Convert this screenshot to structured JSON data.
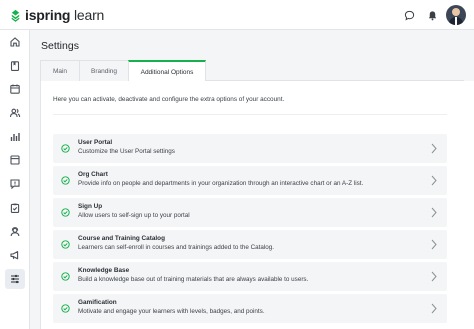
{
  "app": {
    "logo_main": "ispring",
    "logo_accent": "learn"
  },
  "header_icons": [
    "chat-icon",
    "bell-icon",
    "user-avatar"
  ],
  "sidebar": {
    "items": [
      {
        "icon": "home-icon"
      },
      {
        "icon": "courses-icon"
      },
      {
        "icon": "calendar-icon"
      },
      {
        "icon": "users-icon"
      },
      {
        "icon": "reports-icon"
      },
      {
        "icon": "content-icon"
      },
      {
        "icon": "feedback-icon"
      },
      {
        "icon": "assignments-icon"
      },
      {
        "icon": "support-icon"
      },
      {
        "icon": "announcements-icon"
      },
      {
        "icon": "settings-sliders-icon",
        "active": true
      }
    ]
  },
  "page": {
    "title": "Settings",
    "tabs": [
      {
        "label": "Main"
      },
      {
        "label": "Branding"
      },
      {
        "label": "Additional Options",
        "active": true
      }
    ],
    "intro": "Here you can activate, deactivate and configure the extra options of your account."
  },
  "options": [
    {
      "name": "User Portal",
      "description": "Customize the User Portal settings",
      "enabled": true
    },
    {
      "name": "Org Chart",
      "description": "Provide info on people and departments in your organization through an interactive chart or an A-Z list.",
      "enabled": true
    },
    {
      "name": "Sign Up",
      "description": "Allow users to self-sign up to your portal",
      "enabled": true
    },
    {
      "name": "Course and Training Catalog",
      "description": "Learners can self-enroll in courses and trainings added to the Catalog.",
      "enabled": true
    },
    {
      "name": "Knowledge Base",
      "description": "Build a knowledge base out of training materials that are always available to users.",
      "enabled": true
    },
    {
      "name": "Gamification",
      "description": "Motivate and engage your learners with levels, badges, and points.",
      "enabled": true
    }
  ],
  "colors": {
    "accent": "#16b14c",
    "option_bg": "#f4f5f7"
  }
}
